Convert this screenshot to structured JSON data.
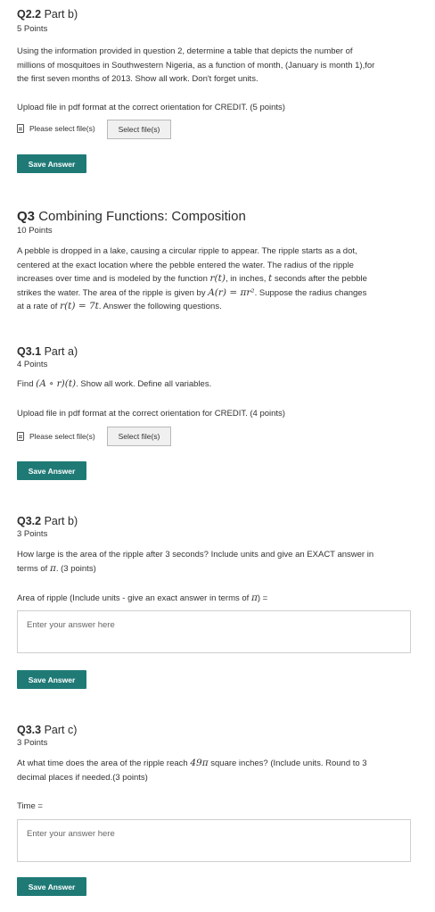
{
  "q22": {
    "num": "Q2.2",
    "title": "Part b)",
    "points": "5 Points",
    "body_lines": [
      "Using the information provided in question 2, determine a table that depicts the number of",
      "millions of mosquitoes in Southwestern Nigeria, as a function of month, (January is month 1),for",
      "the first seven months of 2013. Show all work. Don't forget units."
    ],
    "upload_text": "Upload file in pdf format at the correct orientation for CREDIT. (5 points)",
    "file_label": "Please select file(s)",
    "select_button": "Select file(s)",
    "save_button": "Save Answer"
  },
  "q3": {
    "num": "Q3",
    "title": "Combining Functions: Composition",
    "points": "10 Points",
    "line1": "A pebble is dropped in a lake, causing a circular ripple to appear. The ripple starts as a dot,",
    "line2": "centered at the exact location where the pebble entered the water. The radius of the ripple",
    "line3_a": "increases over time and is modeled by the function ",
    "line3_m1": "r(t)",
    "line3_b": ", in inches, ",
    "line3_m2": "t",
    "line3_c": " seconds after the pebble",
    "line4_a": "strikes the water. The area of the ripple is given by ",
    "line4_m": "A(r) = πr²",
    "line4_b": ". Suppose the radius changes",
    "line5_a": "at a rate of ",
    "line5_m": "r(t) = 7t",
    "line5_b": ". Answer the following questions."
  },
  "q31": {
    "num": "Q3.1",
    "title": "Part a)",
    "points": "4 Points",
    "find_a": "Find ",
    "find_m": "(A ∘ r)(t)",
    "find_b": ". Show all work. Define all variables.",
    "upload_text": "Upload file in pdf format at the correct orientation for CREDIT. (4 points)",
    "file_label": "Please select file(s)",
    "select_button": "Select file(s)",
    "save_button": "Save Answer"
  },
  "q32": {
    "num": "Q3.2",
    "title": "Part b)",
    "points": "3 Points",
    "line1": "How large is the area of the ripple after 3 seconds? Include units and give an EXACT answer in",
    "line2_a": "terms of ",
    "line2_m": "π",
    "line2_b": ". (3 points)",
    "label_a": "Area of ripple (Include units - give an exact answer in terms of ",
    "label_m": "π",
    "label_b": ") =",
    "placeholder": "Enter your answer here",
    "save_button": "Save Answer"
  },
  "q33": {
    "num": "Q3.3",
    "title": "Part c)",
    "points": "3 Points",
    "line1_a": "At what time does the area of the ripple reach ",
    "line1_m": "49π",
    "line1_b": " square inches? (Include units. Round to 3",
    "line2": "decimal places if needed.(3 points)",
    "label": "Time =",
    "placeholder": "Enter your answer here",
    "save_button": "Save Answer"
  }
}
